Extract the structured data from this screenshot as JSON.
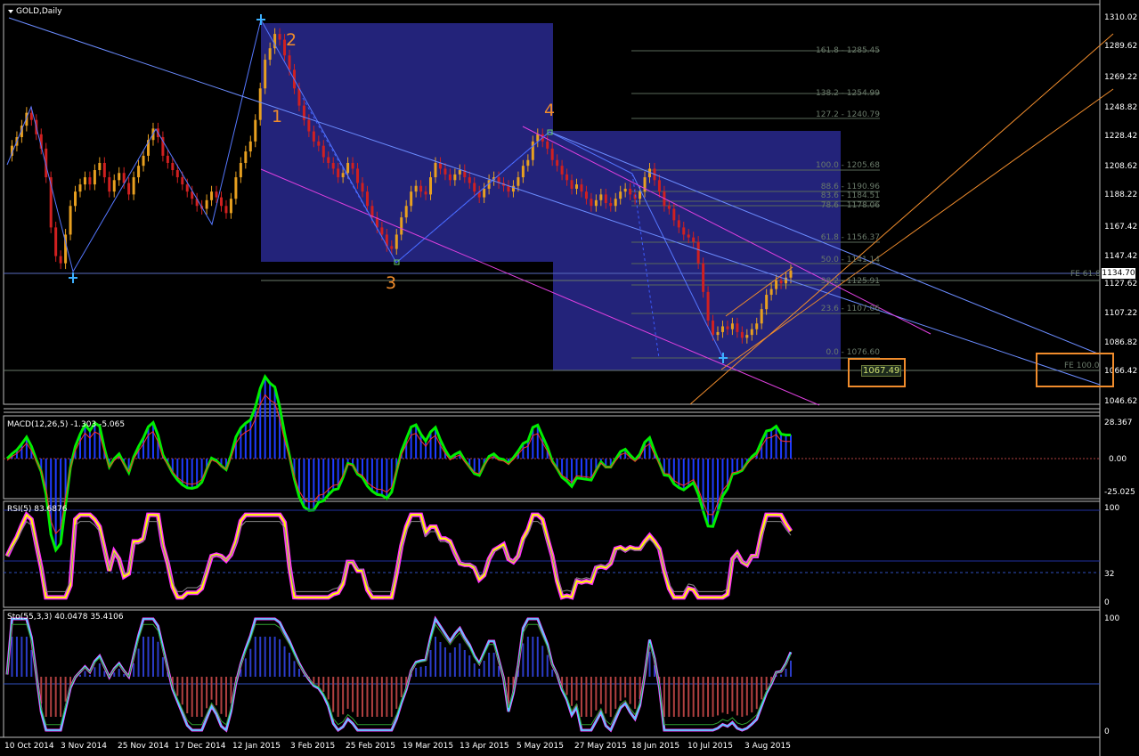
{
  "main": {
    "title": "GOLD,Daily",
    "price_axis": [
      "1310.02",
      "1289.62",
      "1269.22",
      "1248.82",
      "1228.42",
      "1208.62",
      "1188.22",
      "1167.42",
      "1147.42",
      "1127.62",
      "1107.22",
      "1086.82",
      "1066.42",
      "1046.62"
    ],
    "current_price": "1134.70",
    "fib_levels": [
      "161.8 - 1285.45",
      "138.2 - 1254.99",
      "127.2 - 1240.79",
      "100.0 - 1205.68",
      "88.6 - 1190.96",
      "83.6 - 1184.51",
      "78.6 - 1178.06",
      "61.8 - 1156.37",
      "50.0 - 1141.14",
      "38.2 - 1125.91",
      "23.6 - 1107.06",
      "0.0 - 1076.60"
    ],
    "wave_labels": [
      "1",
      "2",
      "3",
      "4"
    ],
    "fe_618": "FE 61.8",
    "fe_100": "FE 100.0",
    "target": "1067.49"
  },
  "macd": {
    "title": "MACD(12,26,5) -1.303 -5.065",
    "axis": [
      "28.367",
      "0.00",
      "-25.025"
    ]
  },
  "rsi": {
    "title": "RSI(5) 83.6876",
    "axis": [
      "100",
      "32",
      "0"
    ]
  },
  "sto": {
    "title": "Sto(55,3,3) 40.0478 35.4106",
    "axis": [
      "100",
      "0"
    ]
  },
  "dates": [
    "10 Oct 2014",
    "3 Nov 2014",
    "25 Nov 2014",
    "17 Dec 2014",
    "12 Jan 2015",
    "3 Feb 2015",
    "25 Feb 2015",
    "19 Mar 2015",
    "13 Apr 2015",
    "5 May 2015",
    "27 May 2015",
    "18 Jun 2015",
    "10 Jul 2015",
    "3 Aug 2015"
  ],
  "colors": {
    "bull": "#e8a020",
    "bear": "#d02020",
    "box": "#23237a",
    "macd_fast": "#00ee00",
    "rsi": "#ffff00"
  }
}
